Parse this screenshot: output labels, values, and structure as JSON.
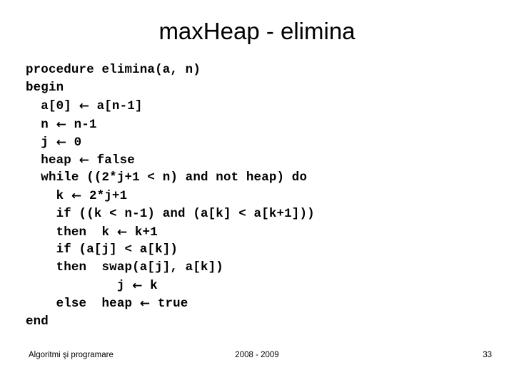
{
  "slide": {
    "title": "maxHeap - elimina",
    "background_color": "#ffffff",
    "text_color": "#000000",
    "arrow_glyph": "←",
    "code_lines": [
      {
        "indent": "",
        "text": "procedure elimina(a, n)"
      },
      {
        "indent": "",
        "text": "begin"
      },
      {
        "indent": "  ",
        "text": "a[0] ← a[n-1]"
      },
      {
        "indent": "  ",
        "text": "n ← n-1"
      },
      {
        "indent": "  ",
        "text": "j ← 0"
      },
      {
        "indent": "  ",
        "text": "heap ← false"
      },
      {
        "indent": "  ",
        "text": "while ((2*j+1 < n) and not heap) do"
      },
      {
        "indent": "    ",
        "text": "k ← 2*j+1"
      },
      {
        "indent": "    ",
        "text": "if ((k < n-1) and (a[k] < a[k+1]))"
      },
      {
        "indent": "    ",
        "text": "then  k ← k+1"
      },
      {
        "indent": "    ",
        "text": "if (a[j] < a[k])"
      },
      {
        "indent": "    ",
        "text": "then  swap(a[j], a[k])"
      },
      {
        "indent": "            ",
        "text": "j ← k"
      },
      {
        "indent": "    ",
        "text": "else  heap ← true"
      },
      {
        "indent": "",
        "text": "end"
      }
    ],
    "footer": {
      "left": "Algoritmi şi programare",
      "center": "2008 - 2009",
      "page_number": "33"
    }
  }
}
